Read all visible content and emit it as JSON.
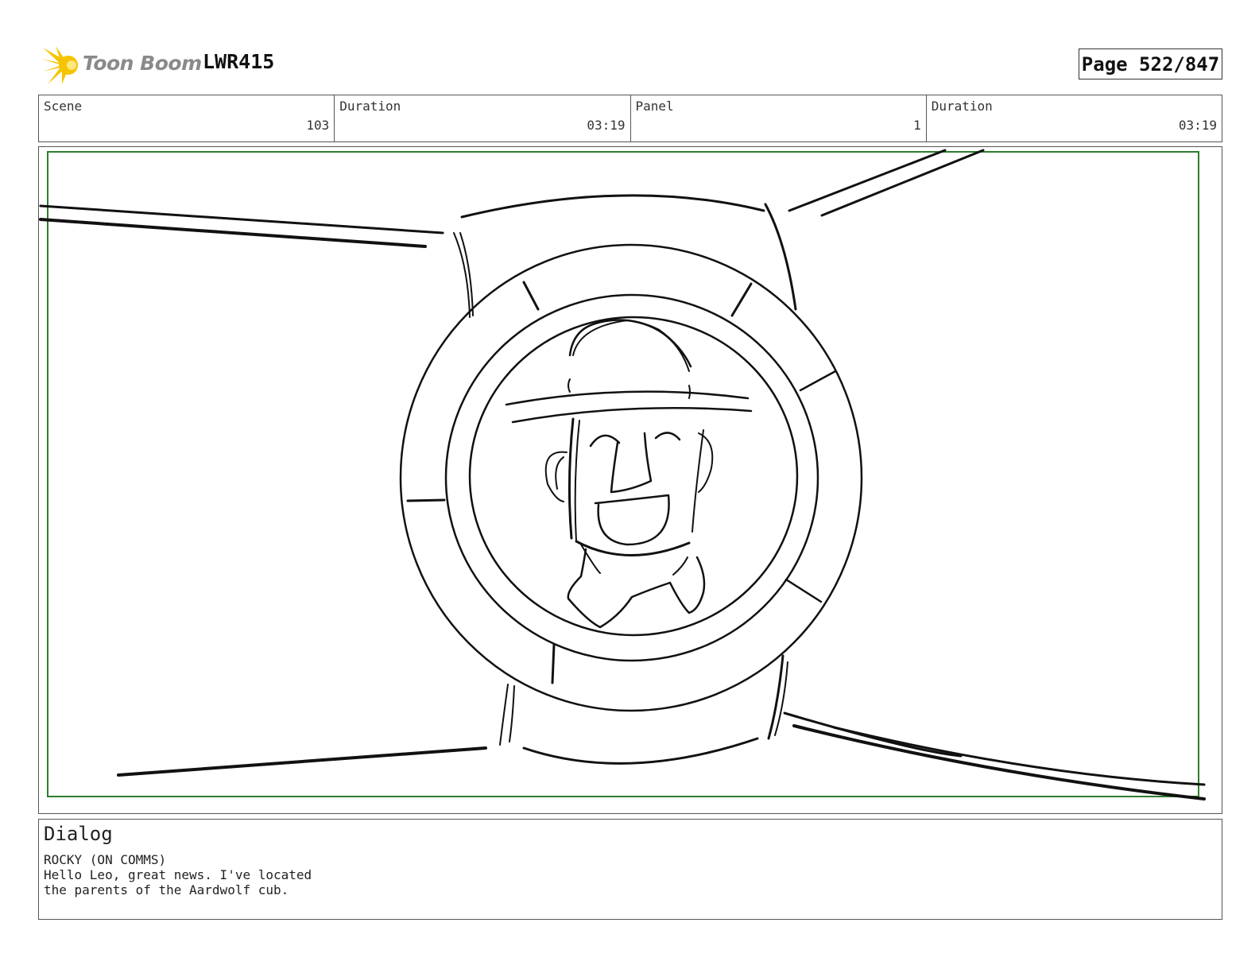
{
  "header": {
    "logo_text": "Toon Boom",
    "logo_icon": "toon-boom-burst-icon",
    "project": "LWR415",
    "page": "Page 522/847"
  },
  "info": {
    "scene_label": "Scene",
    "scene_value": "103",
    "scene_duration_label": "Duration",
    "scene_duration_value": "03:19",
    "panel_label": "Panel",
    "panel_value": "1",
    "panel_duration_label": "Duration",
    "panel_duration_value": "03:19"
  },
  "colors": {
    "safe_frame": "#2e7d2e",
    "logo_yellow": "#f5c400",
    "ink": "#111111"
  },
  "dialog": {
    "title": "Dialog",
    "line1": "ROCKY (ON COMMS)",
    "line2": "Hello Leo, great news. I've located",
    "line3": "the parents of the Aardwolf cub."
  }
}
